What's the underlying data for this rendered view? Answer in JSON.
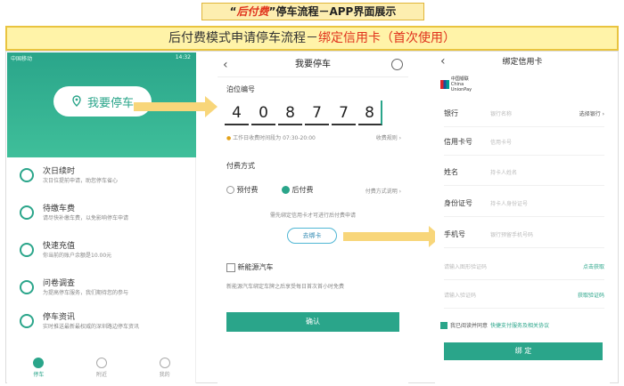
{
  "header": {
    "quote_open": "“",
    "highlight": "后付费",
    "quote_close": "”",
    "title_rest": "停车流程－APP界面展示",
    "subtitle_main": "后付费模式申请停车流程－",
    "subtitle_highlight": "绑定信用卡（首次使用）"
  },
  "screen1": {
    "status_left": "中国移动",
    "status_time": "14:32",
    "park_button": "我要停车",
    "menu": [
      {
        "title": "次日续时",
        "desc": "次日位提前申请，助您停车省心",
        "icon": "clock-icon"
      },
      {
        "title": "待缴车费",
        "desc": "请尽快补缴车费，以免影响停车申请",
        "icon": "bill-icon"
      },
      {
        "title": "快速充值",
        "desc": "你当前的账户余额是10.00元",
        "icon": "yen-icon"
      },
      {
        "title": "问卷调查",
        "desc": "为提高停车服务，我们期待您的参与",
        "icon": "survey-icon"
      },
      {
        "title": "停车资讯",
        "desc": "实时推送最新最权威的深圳路边停车资讯",
        "icon": "news-icon"
      }
    ],
    "nav": [
      {
        "label": "停车",
        "icon": "parking-icon"
      },
      {
        "label": "附近",
        "icon": "location-icon"
      },
      {
        "label": "我的",
        "icon": "person-icon"
      }
    ]
  },
  "screen2": {
    "title": "我要停车",
    "berth_label": "泊位编号",
    "digits": [
      "4",
      "0",
      "8",
      "7",
      "7",
      "8"
    ],
    "work_time": "工作日收费时间段为 07:30-20:00",
    "fee_rule": "收费规则 ›",
    "pay_label": "付费方式",
    "prepaid": "预付费",
    "postpaid": "后付费",
    "pay_note": "付费方式说明 ›",
    "bind_hint": "需先绑定信用卡才可进行后付费申请",
    "bind_button": "去绑卡",
    "ev_label": "新能源汽车",
    "ev_note": "新能源汽车绑定车牌之后享受每日首次首小时免费",
    "confirm": "确认"
  },
  "screen3": {
    "title": "绑定信用卡",
    "unionpay_cn": "中国银联",
    "unionpay_en": "China UnionPay",
    "rows": [
      {
        "key": "银行",
        "placeholder": "银行名称",
        "right": "选择银行 ›"
      },
      {
        "key": "信用卡号",
        "placeholder": "信用卡号",
        "right": ""
      },
      {
        "key": "姓名",
        "placeholder": "持卡人姓名",
        "right": ""
      },
      {
        "key": "身份证号",
        "placeholder": "持卡人身份证号",
        "right": ""
      },
      {
        "key": "手机号",
        "placeholder": "银行预留手机号码",
        "right": ""
      }
    ],
    "code1_placeholder": "请输入图形验证码",
    "code1_action": "点击获取",
    "code2_placeholder": "请输入验证码",
    "code2_action": "获取验证码",
    "agree_text": "我已阅读并同意",
    "agree_link": "快捷支付服务及相关协议",
    "bind_button": "绑 定"
  },
  "colors": {
    "accent": "#2aa58a",
    "highlight": "#e0321c",
    "banner": "#fff3a8",
    "arrow": "#f8d67a"
  }
}
